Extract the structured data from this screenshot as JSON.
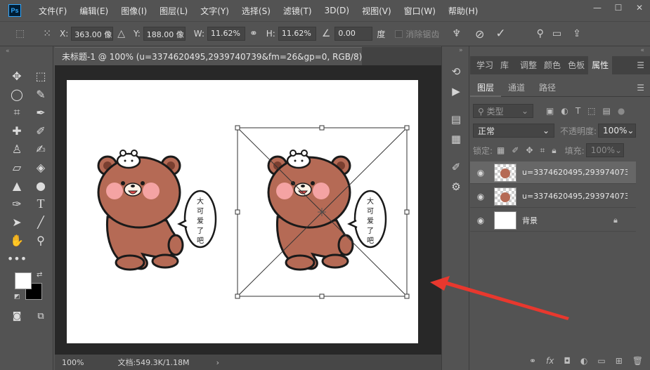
{
  "app": {
    "logo": "Ps"
  },
  "menu": [
    "文件(F)",
    "编辑(E)",
    "图像(I)",
    "图层(L)",
    "文字(Y)",
    "选择(S)",
    "滤镜(T)",
    "3D(D)",
    "视图(V)",
    "窗口(W)",
    "帮助(H)"
  ],
  "options": {
    "x_label": "X:",
    "x_value": "363.00 像",
    "y_label": "Y:",
    "y_value": "188.00 像",
    "w_label": "W:",
    "w_value": "11.62%",
    "h_label": "H:",
    "h_value": "11.62%",
    "angle_value": "0.00",
    "angle_unit": "度",
    "interp_label": "消除锯齿"
  },
  "document": {
    "tab_title": "未标题-1 @ 100% (u=3374620495,2939740739&fm=26&gp=0, RGB/8) *",
    "zoom": "100%",
    "doc_size": "文档:549.3K/1.18M"
  },
  "speech": {
    "line1": "大",
    "line2": "可",
    "line3": "爱",
    "line4": "了",
    "line5": "吧"
  },
  "panel_tabs": [
    "学习",
    "库",
    "调整",
    "颜色",
    "色板",
    "属性"
  ],
  "panel_active": "属性",
  "layers_tabs": [
    "图层",
    "通道",
    "路径"
  ],
  "layers": {
    "filter_label": "类型",
    "blend_mode": "正常",
    "opacity_label": "不透明度:",
    "opacity_value": "100%",
    "lock_label": "锁定:",
    "fill_label": "填充:",
    "fill_value": "100%",
    "items": [
      {
        "name": "u=3374620495,293974073...",
        "selected": true
      },
      {
        "name": "u=3374620495,293974073...",
        "selected": false
      },
      {
        "name": "背景",
        "selected": false
      }
    ]
  },
  "colors": {
    "accent": "#31a8ff",
    "arrow": "#e8382e",
    "bear": "#b56a55",
    "cheek": "#f4a3a3"
  }
}
